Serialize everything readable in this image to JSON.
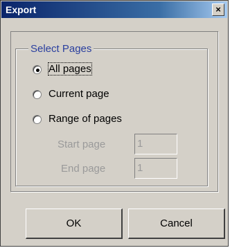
{
  "window": {
    "title": "Export",
    "close_glyph": "×"
  },
  "group": {
    "label": "Select Pages"
  },
  "options": [
    {
      "label": "All pages",
      "selected": true
    },
    {
      "label": "Current page",
      "selected": false
    },
    {
      "label": "Range of pages",
      "selected": false
    }
  ],
  "range": {
    "start_label": "Start page",
    "start_value": "1",
    "end_label": "End page",
    "end_value": "1"
  },
  "buttons": {
    "ok": "OK",
    "cancel": "Cancel"
  }
}
